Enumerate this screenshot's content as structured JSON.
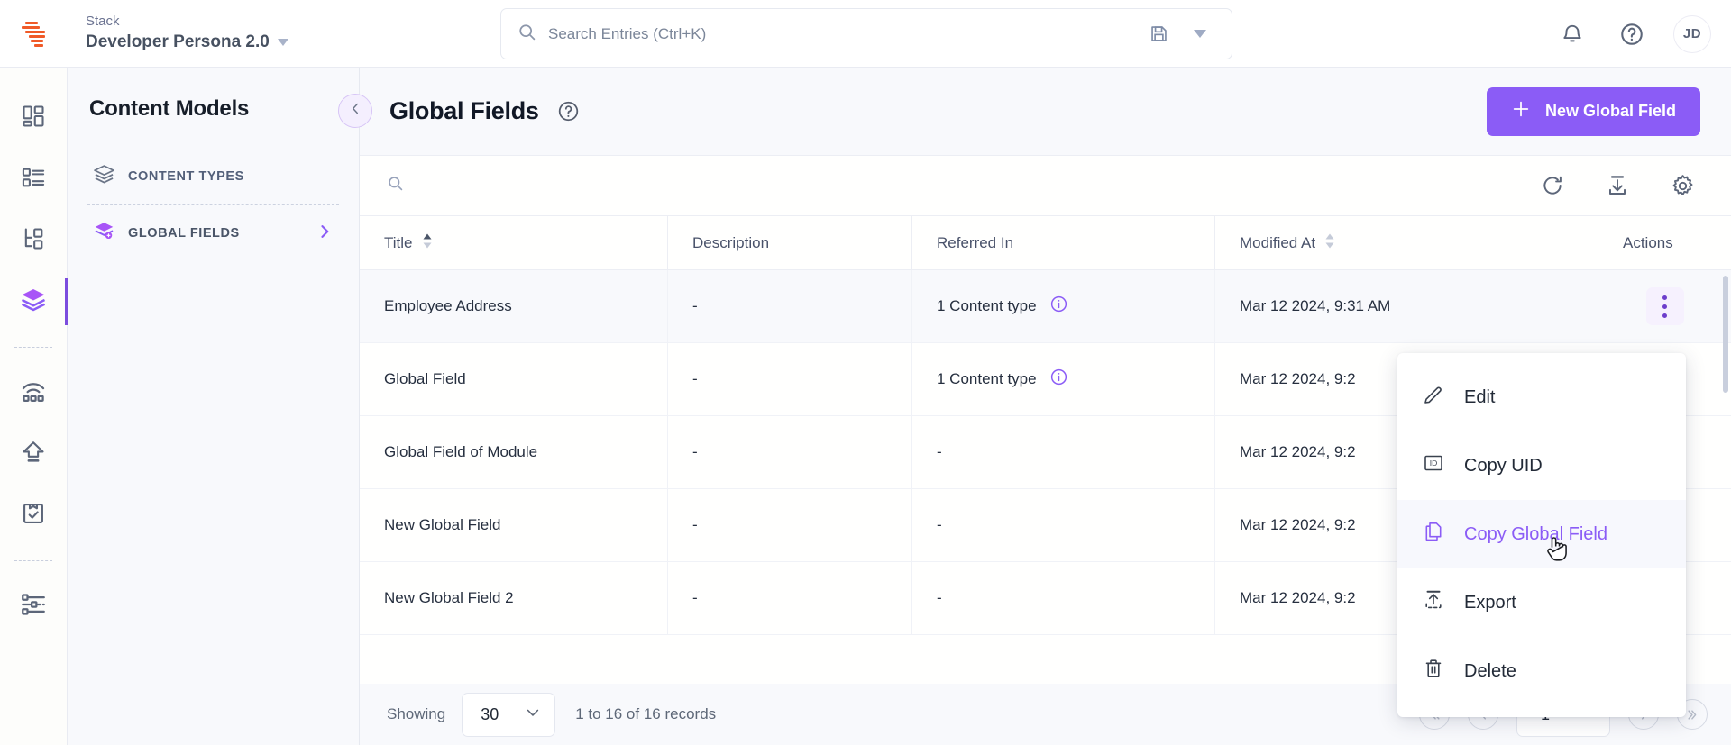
{
  "topbar": {
    "logo_name": "contentstack-logo",
    "stack_label": "Stack",
    "stack_name": "Developer Persona 2.0",
    "search_placeholder": "Search Entries (Ctrl+K)",
    "search_value": "",
    "save_icon": "floppy-disk-icon",
    "dropdown_icon": "caret-down-icon",
    "notification_icon": "bell-icon",
    "help_icon": "question-circle-icon",
    "avatar_initials": "JD"
  },
  "rail": {
    "items": [
      {
        "name": "dashboard-icon",
        "active": false
      },
      {
        "name": "entries-list-icon",
        "active": false
      },
      {
        "name": "hierarchy-icon",
        "active": false
      },
      {
        "name": "content-models-icon",
        "active": true
      },
      {
        "name": "live-preview-icon",
        "active": false
      },
      {
        "name": "publish-icon",
        "active": false
      },
      {
        "name": "tasks-clipboard-icon",
        "active": false
      },
      {
        "name": "settings-sliders-icon",
        "active": false
      }
    ]
  },
  "models_panel": {
    "title": "Content Models",
    "items": [
      {
        "label": "CONTENT TYPES",
        "icon": "layers-icon",
        "selected": false
      },
      {
        "label": "GLOBAL FIELDS",
        "icon": "global-fields-icon",
        "selected": true
      }
    ]
  },
  "page": {
    "back_icon": "chevron-left-icon",
    "title": "Global Fields",
    "help_icon": "question-circle-icon",
    "new_button_label": "New Global Field",
    "new_button_icon": "plus-icon",
    "accent_color": "#8b5cf6"
  },
  "toolbar": {
    "search_icon": "search-icon",
    "search_placeholder": "",
    "search_value": "",
    "refresh_icon": "refresh-icon",
    "download_icon": "download-icon",
    "settings_icon": "gear-icon"
  },
  "table": {
    "columns": [
      {
        "label": "Title",
        "sort": "asc"
      },
      {
        "label": "Description",
        "sort": null
      },
      {
        "label": "Referred In",
        "sort": null
      },
      {
        "label": "Modified At",
        "sort": "none"
      },
      {
        "label": "Actions",
        "sort": null
      }
    ],
    "rows": [
      {
        "title": "Employee Address",
        "description": "-",
        "referred_in": "1 Content type",
        "referred_info_icon": "info-icon",
        "modified_at": "Mar 12 2024, 9:31 AM",
        "menu_open": true
      },
      {
        "title": "Global Field",
        "description": "-",
        "referred_in": "1 Content type",
        "referred_info_icon": "info-icon",
        "modified_at": "Mar 12 2024, 9:2",
        "menu_open": false
      },
      {
        "title": "Global Field of Module",
        "description": "-",
        "referred_in": "-",
        "referred_info_icon": null,
        "modified_at": "Mar 12 2024, 9:2",
        "menu_open": false
      },
      {
        "title": "New Global Field",
        "description": "-",
        "referred_in": "-",
        "referred_info_icon": null,
        "modified_at": "Mar 12 2024, 9:2",
        "menu_open": false
      },
      {
        "title": "New Global Field 2",
        "description": "-",
        "referred_in": "-",
        "referred_info_icon": null,
        "modified_at": "Mar 12 2024, 9:2",
        "menu_open": false
      }
    ]
  },
  "footer": {
    "showing_label": "Showing",
    "page_size": "30",
    "records_label": "1 to 16 of 16 records",
    "first_icon": "double-chevron-left-icon",
    "prev_icon": "chevron-left-icon",
    "page_number": "1",
    "next_icon": "chevron-right-icon",
    "last_icon": "double-chevron-right-icon"
  },
  "context_menu": {
    "items": [
      {
        "label": "Edit",
        "icon": "pencil-icon",
        "highlighted": false
      },
      {
        "label": "Copy UID",
        "icon": "id-badge-icon",
        "highlighted": false
      },
      {
        "label": "Copy Global Field",
        "icon": "copy-icon",
        "highlighted": true
      },
      {
        "label": "Export",
        "icon": "export-upload-icon",
        "highlighted": false
      },
      {
        "label": "Delete",
        "icon": "trash-icon",
        "highlighted": false
      }
    ]
  }
}
